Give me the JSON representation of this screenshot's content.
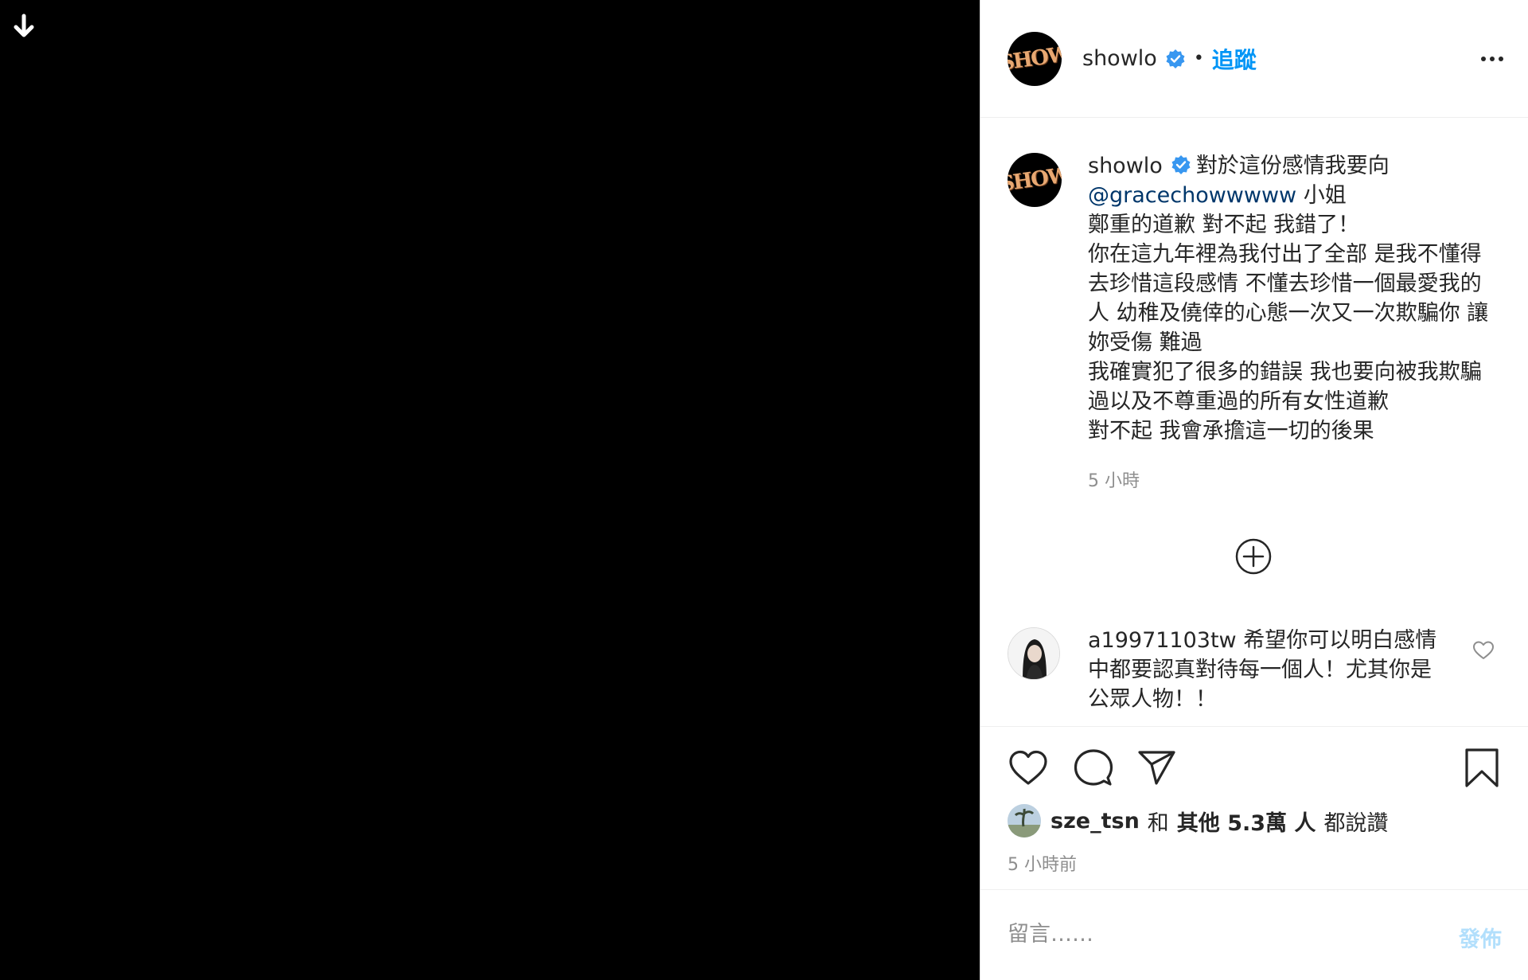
{
  "media": {
    "download_icon": "arrow-down-icon"
  },
  "header": {
    "avatar_text": "SHOW",
    "username": "showlo",
    "separator": "•",
    "follow_label": "追蹤",
    "more_icon": "more-horizontal-icon",
    "verified_icon": "verified-badge-icon"
  },
  "caption": {
    "avatar_text": "SHOW",
    "username": "showlo",
    "text_start": "對於這份感情我要向",
    "mention": "@gracechowwwww",
    "text_rest": "小姐\n鄭重的道歉 對不起 我錯了！\n你在這九年裡為我付出了全部 是我不懂得去珍惜這段感情 不懂去珍惜一個最愛我的人 幼稚及僥倖的心態一次又一次欺騙你 讓妳受傷 難過\n我確實犯了很多的錯誤 我也要向被我欺騙過以及不尊重過的所有女性道歉\n對不起 我會承擔這一切的後果",
    "time": "5 小時"
  },
  "load_more_icon": "plus-circle-icon",
  "comment": {
    "username": "a19971103tw",
    "text": "希望你可以明白感情中都要認真對待每一個人！尤其你是公眾人物！！",
    "like_icon": "heart-outline-icon"
  },
  "actions": {
    "like_icon": "heart-icon",
    "comment_icon": "comment-bubble-icon",
    "share_icon": "paper-plane-icon",
    "save_icon": "bookmark-icon"
  },
  "likes": {
    "first_user": "sze_tsn",
    "connector": "和",
    "others": "其他 5.3萬 人",
    "suffix": "都說讚"
  },
  "post_time": "5 小時前",
  "comment_box": {
    "placeholder": "留言……",
    "post_label": "發佈"
  }
}
